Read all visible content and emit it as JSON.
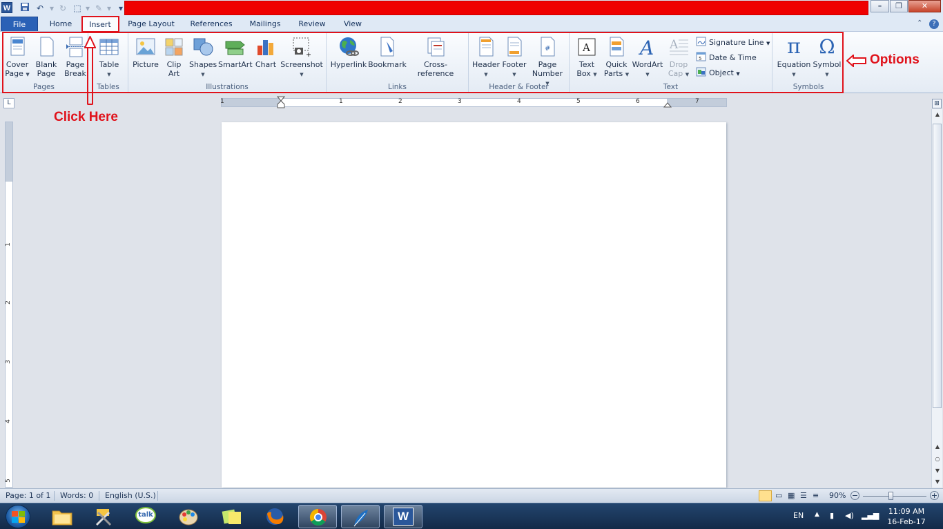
{
  "title_bar": {
    "app_icon_letter": "W",
    "qat_icons": [
      "save-icon",
      "undo-icon",
      "redo-icon",
      "customize-icon"
    ]
  },
  "tabs": [
    "File",
    "Home",
    "Insert",
    "Page Layout",
    "References",
    "Mailings",
    "Review",
    "View"
  ],
  "ribbon": {
    "groups": {
      "pages": "Pages",
      "tables": "Tables",
      "illustrations": "Illustrations",
      "links": "Links",
      "header_footer": "Header & Footer",
      "text": "Text",
      "symbols": "Symbols"
    },
    "commands": {
      "cover_page": [
        "Cover",
        "Page"
      ],
      "blank_page": [
        "Blank",
        "Page"
      ],
      "page_break": [
        "Page",
        "Break"
      ],
      "table": "Table",
      "picture": "Picture",
      "clip_art": [
        "Clip",
        "Art"
      ],
      "shapes": "Shapes",
      "smartart": "SmartArt",
      "chart": "Chart",
      "screenshot": "Screenshot",
      "hyperlink": "Hyperlink",
      "bookmark": "Bookmark",
      "cross_reference": "Cross-reference",
      "header": "Header",
      "footer": "Footer",
      "page_number": [
        "Page",
        "Number"
      ],
      "text_box": [
        "Text",
        "Box"
      ],
      "quick_parts": [
        "Quick",
        "Parts"
      ],
      "wordart": "WordArt",
      "drop_cap": [
        "Drop",
        "Cap"
      ],
      "signature_line": "Signature Line",
      "date_time": "Date & Time",
      "object": "Object",
      "equation": "Equation",
      "symbol": "Symbol",
      "pi_glyph": "π",
      "omega_glyph": "Ω",
      "wordart_glyph": "A",
      "textbox_glyph": "A",
      "dropcap_glyph": "A",
      "pagenum_glyph": "#"
    }
  },
  "annotations": {
    "click_here": "Click Here",
    "options": "Options"
  },
  "ruler": {
    "h_numbers": [
      "1",
      "1",
      "2",
      "3",
      "4",
      "5",
      "6",
      "7"
    ],
    "v_numbers": [
      "1",
      "2",
      "3",
      "4",
      "5"
    ],
    "corner_glyph": "L"
  },
  "status": {
    "page": "Page: 1 of 1",
    "words": "Words: 0",
    "language": "English (U.S.)",
    "zoom": "90%"
  },
  "taskbar": {
    "talk_label": "talk",
    "language": "EN",
    "time": "11:09 AM",
    "date": "16-Feb-17",
    "word_letter": "W"
  },
  "colors": {
    "title_red_bar": "#ef0000",
    "annotation_red": "#e0121b",
    "file_tab": "#2a61b6"
  }
}
